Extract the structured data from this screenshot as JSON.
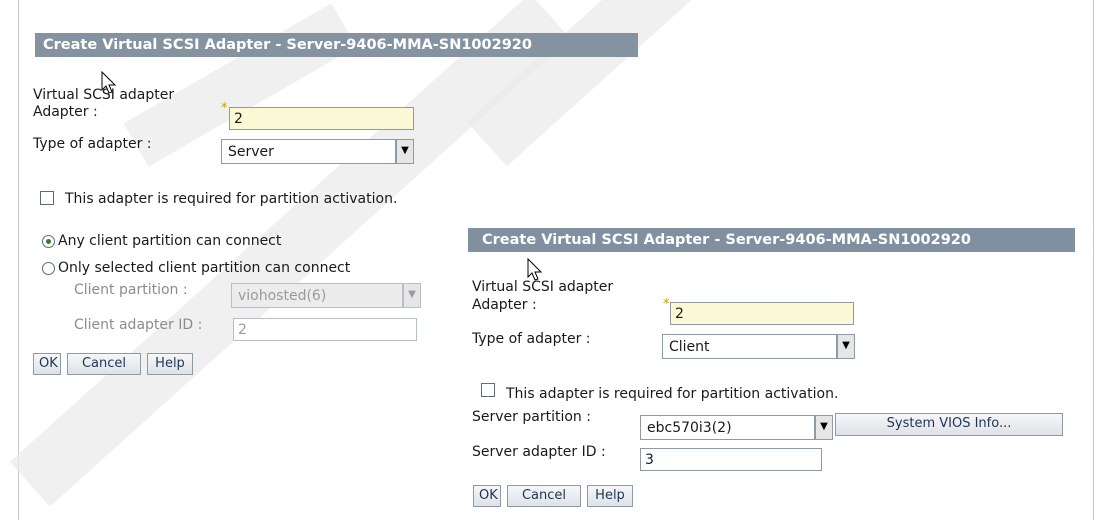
{
  "server_dialog": {
    "title": "Create Virtual SCSI Adapter - Server-9406-MMA-SN1002920",
    "section_label": "Virtual SCSI adapter",
    "adapter_label": "Adapter :",
    "adapter_required_mark": "*",
    "adapter_value": "2",
    "type_label": "Type of adapter :",
    "type_value": "Server",
    "activation_checkbox_label": "This adapter is required for partition activation.",
    "activation_checked": false,
    "radio_any_label": "Any client partition can connect",
    "radio_selected_label": "Only selected client partition can connect",
    "radio_selected_value": "any",
    "client_partition_label": "Client partition :",
    "client_partition_value": "viohosted(6)",
    "client_adapter_id_label": "Client adapter ID :",
    "client_adapter_id_value": "2",
    "buttons": {
      "ok": "OK",
      "cancel": "Cancel",
      "help": "Help"
    }
  },
  "client_dialog": {
    "title": "Create Virtual SCSI Adapter - Server-9406-MMA-SN1002920",
    "section_label": "Virtual SCSI adapter",
    "adapter_label": "Adapter :",
    "adapter_required_mark": "*",
    "adapter_value": "2",
    "type_label": "Type of adapter :",
    "type_value": "Client",
    "activation_checkbox_label": "This adapter is required for partition activation.",
    "activation_checked": false,
    "server_partition_label": "Server partition :",
    "server_partition_value": "ebc570i3(2)",
    "system_vios_button": "System VIOS Info...",
    "server_adapter_id_label": "Server adapter ID :",
    "server_adapter_id_value": "3",
    "buttons": {
      "ok": "OK",
      "cancel": "Cancel",
      "help": "Help"
    }
  },
  "icons": {
    "dropdown": "chevron-down-icon",
    "pointer": "mouse-pointer-icon"
  }
}
